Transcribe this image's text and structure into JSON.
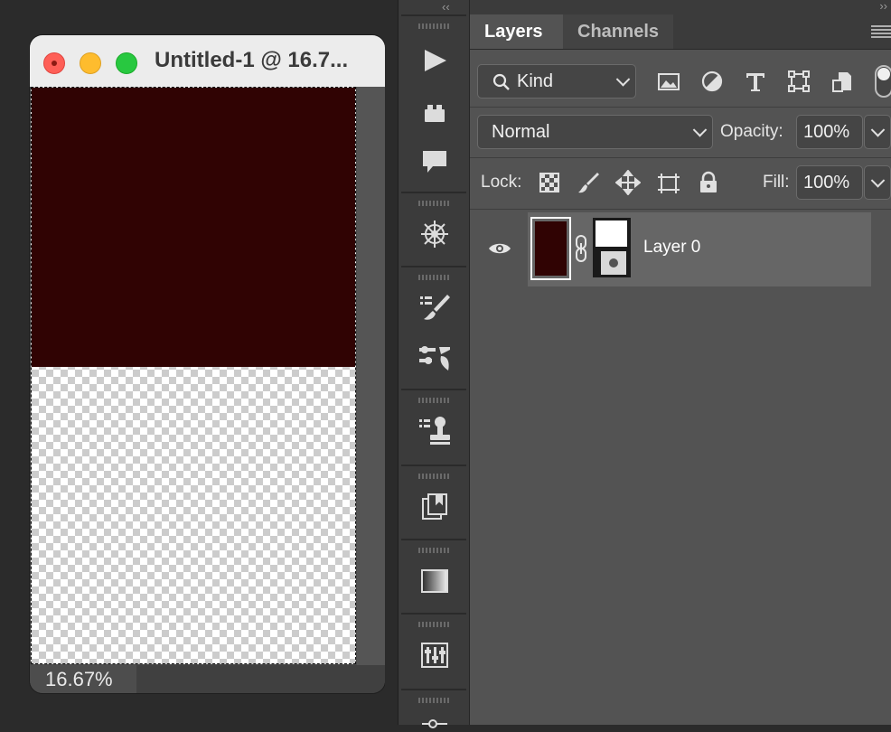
{
  "document": {
    "title": "Untitled-1 @ 16.7...",
    "zoom": "16.67%",
    "fill_color": "#300303",
    "fill_fraction": 0.485
  },
  "toolstrip": {
    "collapse_left": "‹‹",
    "tools": [
      {
        "name": "play-icon"
      },
      {
        "name": "lego-brick-icon"
      },
      {
        "name": "comment-icon"
      },
      {
        "name": "compass-wheel-icon"
      },
      {
        "name": "brush-list-icon"
      },
      {
        "name": "brush-settings-icon"
      },
      {
        "name": "clone-stamp-list-icon"
      },
      {
        "name": "artboard-history-icon"
      },
      {
        "name": "gradient-icon"
      },
      {
        "name": "adjustments-icon"
      },
      {
        "name": "slider-icon"
      }
    ]
  },
  "layers_panel": {
    "collapse_right": "››",
    "tabs": [
      {
        "label": "Layers",
        "active": true
      },
      {
        "label": "Channels",
        "active": false
      }
    ],
    "filter": {
      "label": "Kind"
    },
    "blend_mode": "Normal",
    "opacity_label": "Opacity:",
    "opacity_value": "100%",
    "lock_label": "Lock:",
    "fill_label": "Fill:",
    "fill_value": "100%",
    "layers": [
      {
        "name": "Layer 0",
        "visible": true,
        "thumb_color": "#300303"
      }
    ]
  }
}
